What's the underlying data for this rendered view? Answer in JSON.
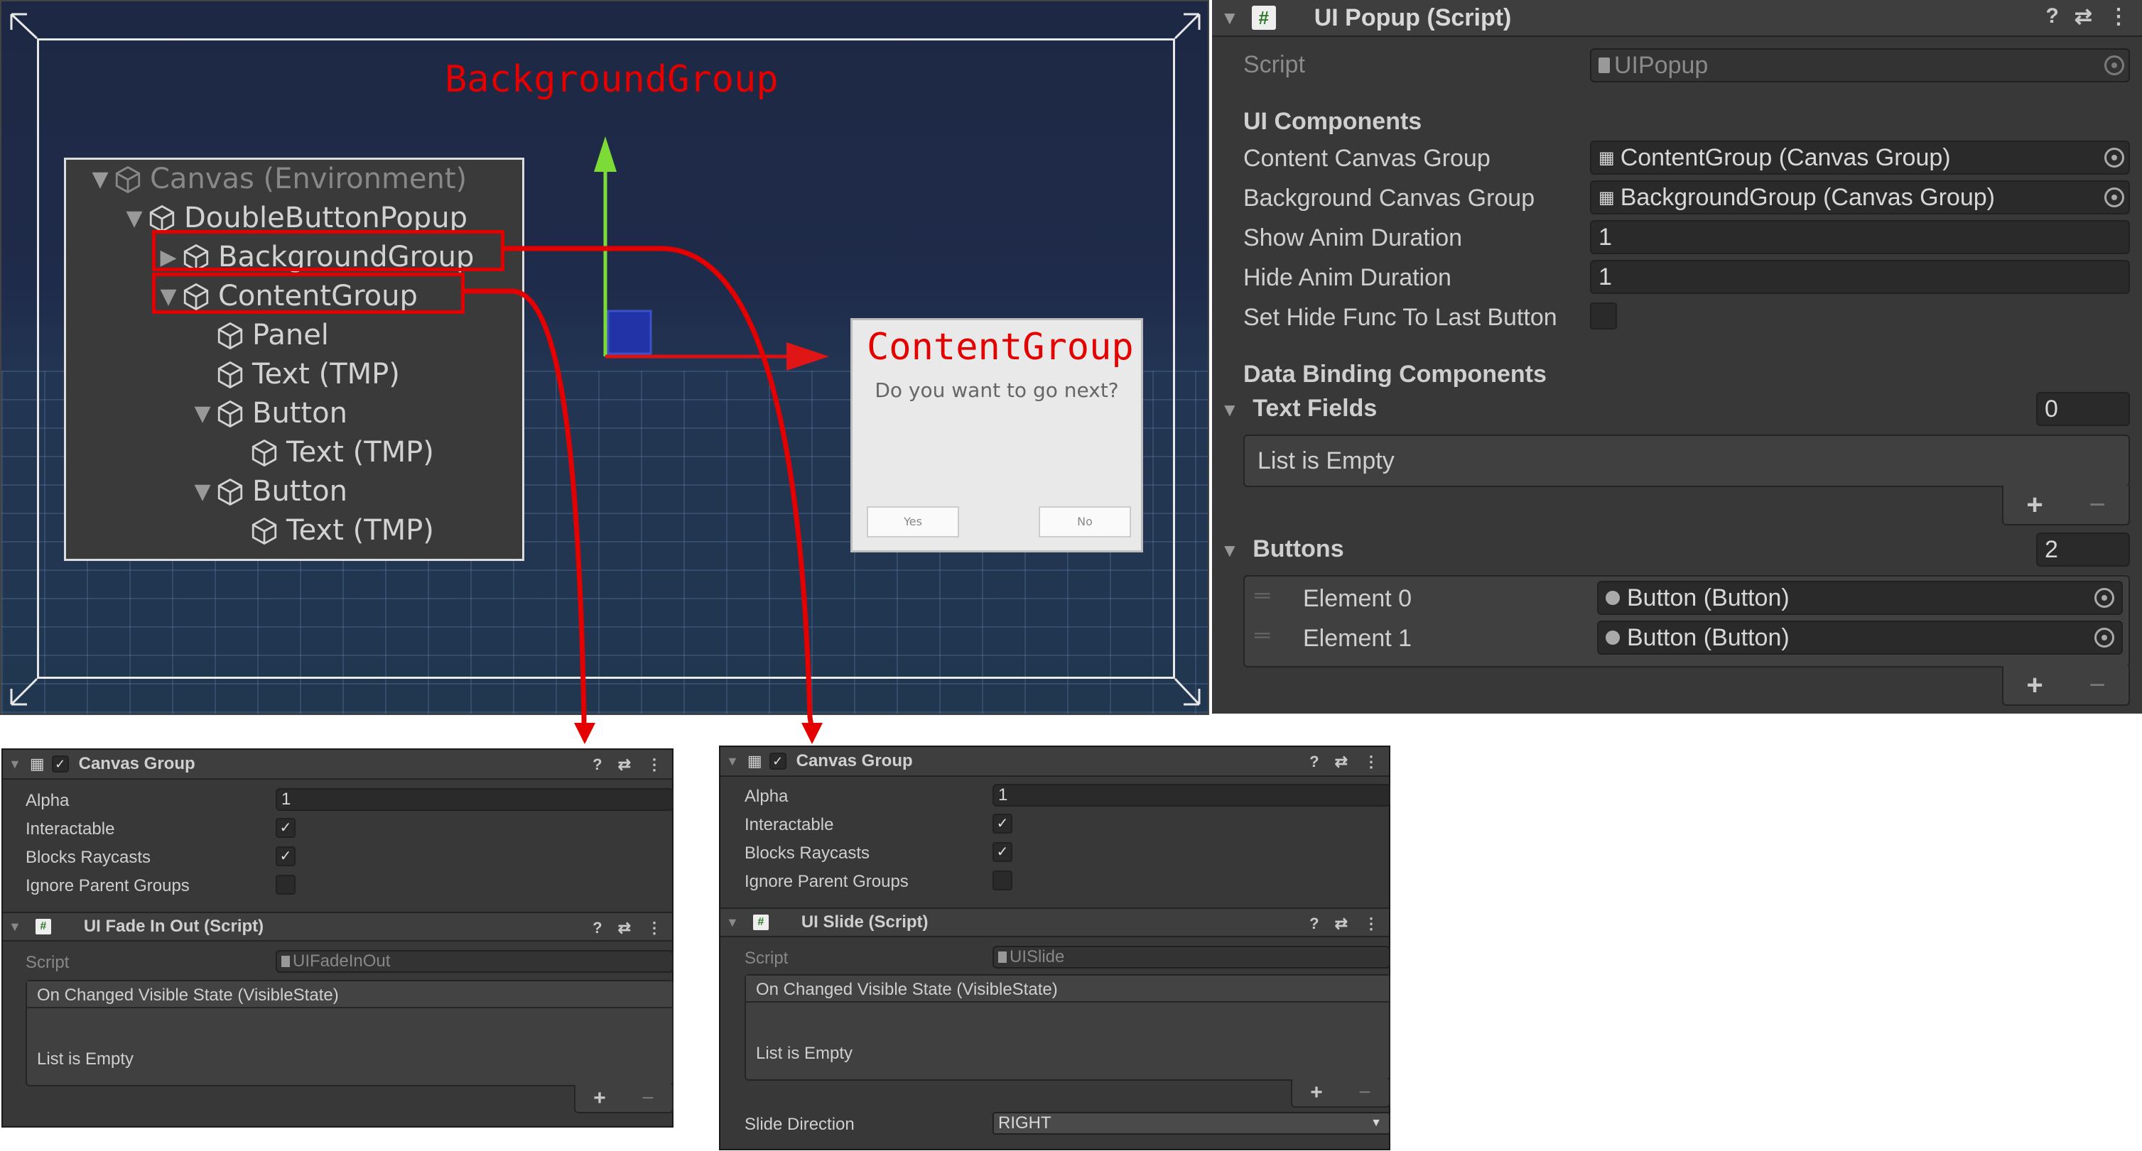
{
  "scene": {
    "background_group_label": "BackgroundGroup",
    "content_group_label": "ContentGroup",
    "popup": {
      "question": "Do you want to go next?",
      "button_yes": "Yes",
      "button_no": "No"
    },
    "hierarchy": [
      {
        "label": "Canvas (Environment)",
        "indent": 0,
        "arrow": "down"
      },
      {
        "label": "DoubleButtonPopup",
        "indent": 1,
        "arrow": "down"
      },
      {
        "label": "BackgroundGroup",
        "indent": 2,
        "arrow": "right"
      },
      {
        "label": "ContentGroup",
        "indent": 2,
        "arrow": "down"
      },
      {
        "label": "Panel",
        "indent": 3,
        "arrow": ""
      },
      {
        "label": "Text (TMP)",
        "indent": 3,
        "arrow": ""
      },
      {
        "label": "Button",
        "indent": 3,
        "arrow": "down"
      },
      {
        "label": "Text (TMP)",
        "indent": 4,
        "arrow": ""
      },
      {
        "label": "Button",
        "indent": 3,
        "arrow": "down"
      },
      {
        "label": "Text (TMP)",
        "indent": 4,
        "arrow": ""
      }
    ]
  },
  "ui_popup": {
    "title": "UI Popup (Script)",
    "script_label": "Script",
    "script_value": "UIPopup",
    "section_ui_components": "UI Components",
    "content_canvas_group_label": "Content Canvas Group",
    "content_canvas_group_value": "ContentGroup (Canvas Group)",
    "background_canvas_group_label": "Background Canvas Group",
    "background_canvas_group_value": "BackgroundGroup (Canvas Group)",
    "show_anim_duration_label": "Show Anim Duration",
    "show_anim_duration_value": "1",
    "hide_anim_duration_label": "Hide Anim Duration",
    "hide_anim_duration_value": "1",
    "set_hide_func_label": "Set Hide Func To Last Button",
    "section_data_binding": "Data Binding Components",
    "text_fields_label": "Text Fields",
    "text_fields_count": "0",
    "text_fields_empty": "List is Empty",
    "buttons_label": "Buttons",
    "buttons_count": "2",
    "buttons": [
      {
        "label": "Element 0",
        "value": "Button (Button)"
      },
      {
        "label": "Element 1",
        "value": "Button (Button)"
      }
    ],
    "plus": "+",
    "minus": "−"
  },
  "left_panel": {
    "canvas_group_title": "Canvas Group",
    "alpha_label": "Alpha",
    "alpha_value": "1",
    "interactable_label": "Interactable",
    "blocks_raycasts_label": "Blocks Raycasts",
    "ignore_parent_label": "Ignore Parent Groups",
    "script_title": "UI Fade In Out (Script)",
    "script_label": "Script",
    "script_value": "UIFadeInOut",
    "event_label": "On Changed Visible State (VisibleState)",
    "empty_label": "List is Empty"
  },
  "right_panel": {
    "canvas_group_title": "Canvas Group",
    "alpha_label": "Alpha",
    "alpha_value": "1",
    "interactable_label": "Interactable",
    "blocks_raycasts_label": "Blocks Raycasts",
    "ignore_parent_label": "Ignore Parent Groups",
    "script_title": "UI Slide (Script)",
    "script_label": "Script",
    "script_value": "UISlide",
    "event_label": "On Changed Visible State (VisibleState)",
    "empty_label": "List is Empty",
    "slide_direction_label": "Slide Direction",
    "slide_direction_value": "RIGHT"
  },
  "colors": {
    "annotation_red": "#e50000",
    "inspector_bg": "#383838",
    "scene_bg": "#1f2b4a"
  }
}
